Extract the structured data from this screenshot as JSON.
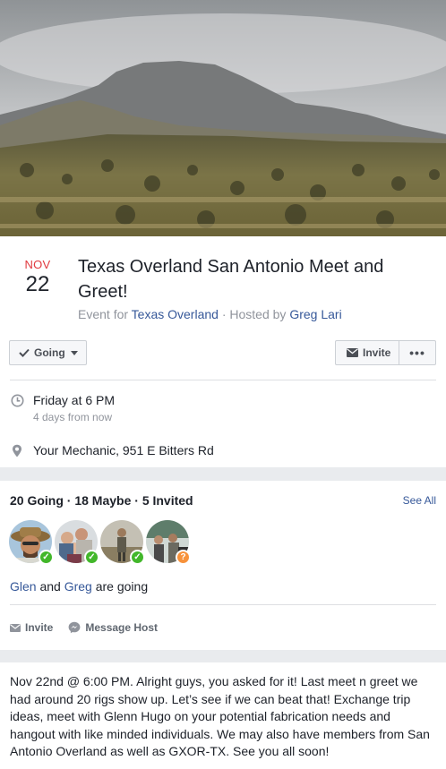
{
  "event": {
    "month": "NOV",
    "day": "22",
    "title": "Texas Overland San Antonio Meet and Greet!",
    "byline_prefix": "Event for ",
    "page_name": "Texas Overland",
    "byline_separator": " · Hosted by ",
    "host_name": "Greg Lari"
  },
  "actions": {
    "going_label": "Going",
    "invite_label": "Invite",
    "more_label": "•••"
  },
  "details": {
    "time_main": "Friday at 6 PM",
    "time_sub": "4 days from now",
    "location": "Your Mechanic, 951 E Bitters Rd"
  },
  "attendance": {
    "summary": "20 Going · 18 Maybe · 5 Invited",
    "see_all": "See All",
    "avatars": [
      {
        "status": "going",
        "badge": "✓"
      },
      {
        "status": "going",
        "badge": "✓"
      },
      {
        "status": "going",
        "badge": "✓"
      },
      {
        "status": "invited",
        "badge": "?"
      }
    ],
    "friend_1": "Glen",
    "friends_and": " and ",
    "friend_2": "Greg",
    "friends_suffix": " are going",
    "invite_action": "Invite",
    "message_action": "Message Host"
  },
  "description": "Nov 22nd @ 6:00 PM. Alright guys, you asked for it! Last meet n greet we had around 20 rigs show up. Let’s see if we can beat that! Exchange trip ideas, meet with Glenn Hugo on your potential fabrication needs and hangout with like minded individuals. We may also have members from San Antonio Overland as well as GXOR-TX. See you all soon!",
  "colors": {
    "link": "#365899",
    "date_month": "#e0393e",
    "going_badge": "#42b72a",
    "invited_badge": "#f7923b"
  }
}
